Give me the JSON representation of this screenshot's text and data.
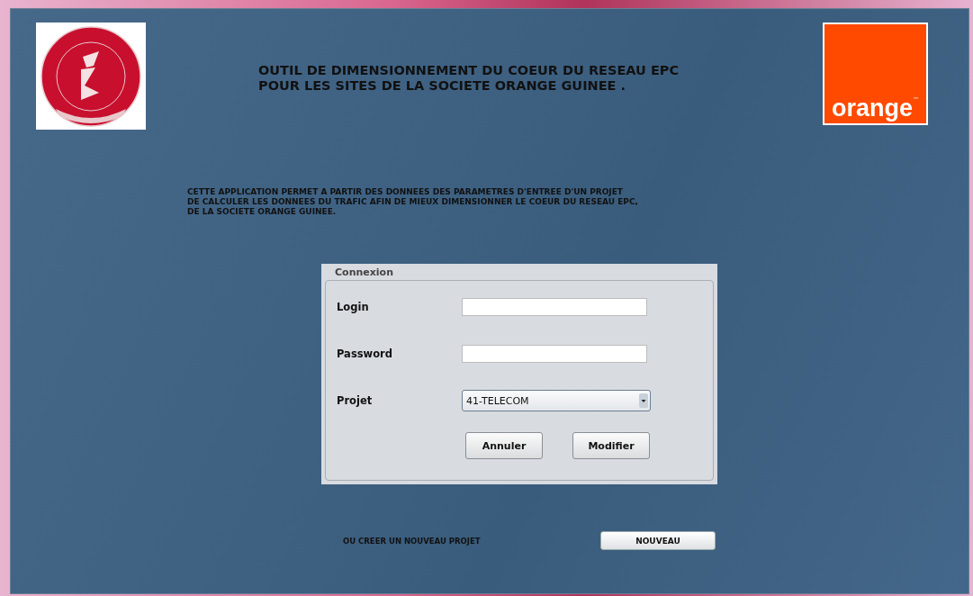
{
  "header": {
    "title_lines": [
      "OUTIL DE DIMENSIONNEMENT DU COEUR DU RESEAU EPC",
      "POUR LES SITES DE LA SOCIETE ORANGE GUINEE ."
    ],
    "brand_logo": {
      "wordmark": "orange",
      "trademark": "™"
    }
  },
  "description": [
    "CETTE APPLICATION PERMET A PARTIR DES DONNEES DES PARAMETRES D'ENTREE D'UN PROJET",
    "DE CALCULER LES DONNEES DU TRAFIC AFIN DE MIEUX DIMENSIONNER LE COEUR DU RESEAU EPC,",
    "DE LA SOCIETE ORANGE GUINEE."
  ],
  "login_panel": {
    "title": "Connexion",
    "fields": [
      {
        "kind": "text",
        "label": "Login"
      },
      {
        "kind": "password",
        "label": "Password"
      },
      {
        "kind": "select",
        "label": "Projet",
        "value": "41-TELECOM"
      }
    ],
    "buttons": [
      "Annuler",
      "Modifier"
    ]
  },
  "new_project": {
    "label": "OU CREER UN NOUVEAU PROJET",
    "button": "NOUVEAU"
  }
}
